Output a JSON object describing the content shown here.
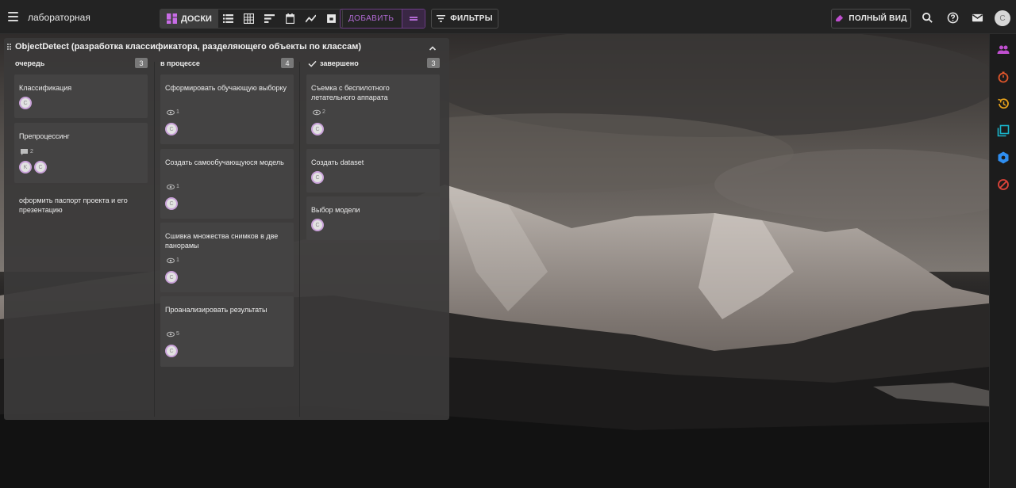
{
  "app": {
    "title": "лабораторная"
  },
  "toolbar": {
    "boards_label": "ДОСКИ",
    "add_label": "ДОБАВИТЬ",
    "filters_label": "ФИЛЬТРЫ",
    "fullview_label": "ПОЛНЫЙ ВИД",
    "user_initial": "C"
  },
  "board": {
    "title": "ObjectDetect (разработка классификатора, разделяющего объекты по классам)",
    "columns": [
      {
        "name": "очередь",
        "count": "3",
        "cards": [
          {
            "title": "Классификация",
            "meta": "",
            "avatars": [
              "C"
            ]
          },
          {
            "title": "Препроцессинг",
            "meta": "2",
            "avatars": [
              "K",
              "C"
            ]
          },
          {
            "title": "оформить паспорт проекта и его презентацию",
            "meta": "",
            "avatars": []
          }
        ]
      },
      {
        "name": "в процессе",
        "count": "4",
        "cards": [
          {
            "title": "Сформировать обучающую выборку",
            "meta": "1",
            "avatars": [
              "C"
            ]
          },
          {
            "title": "Создать самообучающуюся модель",
            "meta": "1",
            "avatars": [
              "C"
            ]
          },
          {
            "title": "Сшивка множества снимков в две панорамы",
            "meta": "1",
            "avatars": [
              "C"
            ]
          },
          {
            "title": "Проанализировать результаты",
            "meta": "5",
            "avatars": [
              "C"
            ]
          }
        ]
      },
      {
        "name": "завершено",
        "count": "3",
        "cards": [
          {
            "title": "Съемка с беспилотного летательного аппарата",
            "meta": "2",
            "avatars": [
              "C"
            ]
          },
          {
            "title": "Создать dataset",
            "meta": "",
            "avatars": [
              "C"
            ]
          },
          {
            "title": "Выбор модели",
            "meta": "",
            "avatars": [
              "C"
            ]
          }
        ]
      }
    ]
  },
  "icons": {
    "rail": [
      "people-icon",
      "timer-icon",
      "history-icon",
      "copy-icon",
      "settings-badge-icon",
      "block-icon"
    ],
    "colors": {
      "accent": "#b16ad3",
      "people": "#c04fd0",
      "timer": "#e0562b",
      "history": "#e8a21a",
      "copy": "#1ab3c9",
      "settings": "#2f8ef0",
      "block": "#e0443a"
    }
  }
}
